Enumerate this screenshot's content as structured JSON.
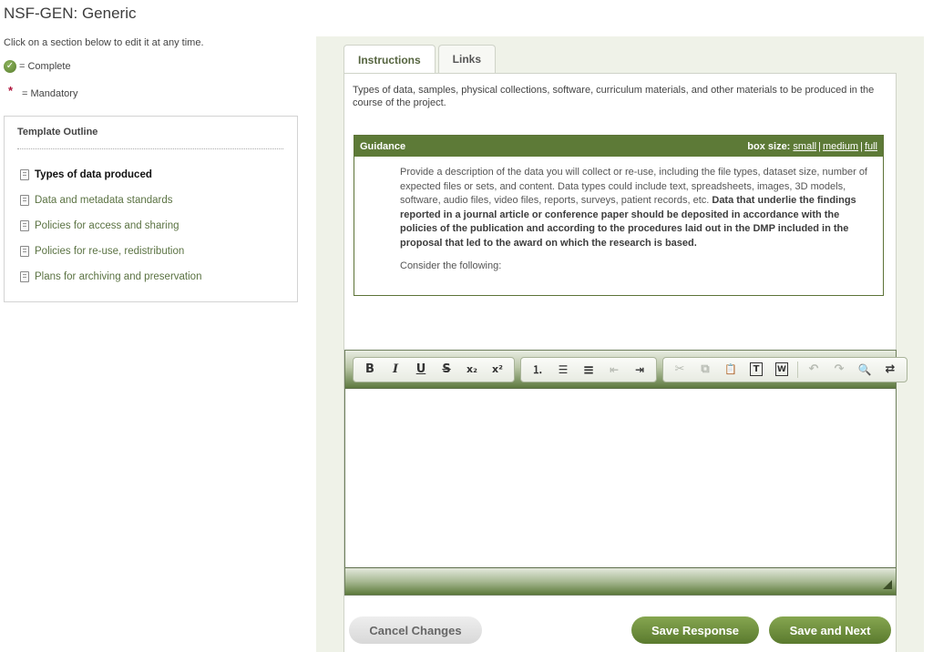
{
  "page": {
    "title": "NSF-GEN: Generic"
  },
  "sidebar": {
    "intro": "Click on a section below to edit it at any time.",
    "legend": {
      "complete_icon": "check-circle-icon",
      "complete_label": "= Complete",
      "mandatory_symbol": "*",
      "mandatory_label": "= Mandatory"
    },
    "outline": {
      "title": "Template Outline",
      "items": [
        {
          "label": "Types of data produced",
          "active": true,
          "icon": "document-icon"
        },
        {
          "label": "Data and metadata standards",
          "active": false,
          "icon": "document-icon"
        },
        {
          "label": "Policies for access and sharing",
          "active": false,
          "icon": "document-icon"
        },
        {
          "label": "Policies for re-use, redistribution",
          "active": false,
          "icon": "document-icon"
        },
        {
          "label": "Plans for archiving and preservation",
          "active": false,
          "icon": "document-icon"
        }
      ]
    }
  },
  "main": {
    "tabs": [
      {
        "label": "Instructions",
        "active": true
      },
      {
        "label": "Links",
        "active": false
      }
    ],
    "section_description": "Types of data, samples, physical collections, software, curriculum materials, and other materials to be produced in the course of the project.",
    "guidance": {
      "title": "Guidance",
      "box_size_label": "box size:",
      "box_size_options": [
        "small",
        "medium",
        "full"
      ],
      "paragraph_plain": "Provide a description of the data you will collect or re-use, including the file types, dataset size, number of expected files or sets, and content. Data types could include text, spreadsheets, images, 3D models, software, audio files, video files, reports, surveys, patient records, etc. ",
      "paragraph_bold": "Data that underlie the findings reported in a journal article or conference paper should be deposited in accordance with the policies of the publication and according to the procedures laid out in the DMP included in the proposal that led to the award on which the research is based.",
      "consider": "Consider the following:"
    },
    "editor": {
      "toolbar_groups": [
        [
          {
            "name": "bold",
            "glyph": "B",
            "enabled": true
          },
          {
            "name": "italic",
            "glyph": "I",
            "enabled": true
          },
          {
            "name": "underline",
            "glyph": "U",
            "enabled": true
          },
          {
            "name": "strikethrough",
            "glyph": "S",
            "enabled": true
          },
          {
            "name": "subscript",
            "glyph": "x₂",
            "enabled": true
          },
          {
            "name": "superscript",
            "glyph": "x²",
            "enabled": true
          }
        ],
        [
          {
            "name": "numbered-list",
            "glyph": "⒈",
            "enabled": true
          },
          {
            "name": "bulleted-list",
            "glyph": "☰",
            "enabled": true
          },
          {
            "name": "horizontal-rule",
            "glyph": "≡",
            "enabled": true
          },
          {
            "name": "outdent",
            "glyph": "⇤",
            "enabled": false
          },
          {
            "name": "indent",
            "glyph": "⇥",
            "enabled": true
          }
        ],
        [
          {
            "name": "cut",
            "glyph": "✂",
            "enabled": false
          },
          {
            "name": "copy",
            "glyph": "⧉",
            "enabled": false
          },
          {
            "name": "paste",
            "glyph": "📋",
            "enabled": true
          },
          {
            "name": "paste-text",
            "glyph": "T",
            "enabled": true
          },
          {
            "name": "paste-word",
            "glyph": "W",
            "enabled": true
          },
          {
            "name": "undo",
            "glyph": "↶",
            "enabled": false
          },
          {
            "name": "redo",
            "glyph": "↷",
            "enabled": false
          },
          {
            "name": "find",
            "glyph": "🔍",
            "enabled": true
          },
          {
            "name": "replace",
            "glyph": "⇄",
            "enabled": true
          }
        ]
      ],
      "content": ""
    },
    "buttons": {
      "cancel": "Cancel Changes",
      "save": "Save Response",
      "save_next": "Save and Next"
    }
  },
  "colors": {
    "brand_green": "#5d7a37",
    "panel_bg": "#eff2e8",
    "link_green": "#5b7343",
    "mandatory_red": "#b0143c"
  }
}
